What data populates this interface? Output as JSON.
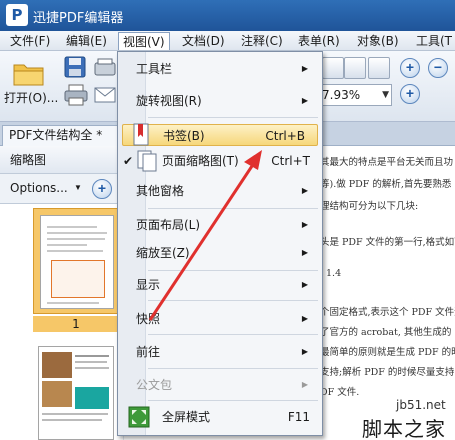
{
  "app": {
    "title": "迅捷PDF编辑器",
    "logo_letter": "P"
  },
  "menubar": {
    "items": [
      {
        "label": "文件(F)"
      },
      {
        "label": "编辑(E)"
      },
      {
        "label": "视图(V)"
      },
      {
        "label": "文档(D)"
      },
      {
        "label": "注释(C)"
      },
      {
        "label": "表单(R)"
      },
      {
        "label": "对象(B)"
      },
      {
        "label": "工具(T"
      }
    ]
  },
  "toolbar": {
    "open_label": "打开(O)...",
    "zoom_value": "7.93%"
  },
  "tabs": {
    "document_tab": "PDF文件结构全 *"
  },
  "panel": {
    "header": "缩略图",
    "options_label": "Options...",
    "thumbnail_page_label": "1"
  },
  "document": {
    "lines": [
      "其最大的特点是平台无关而且功",
      "等).做 PDF 的解析,首先要熟悉",
      "理结构可分为以下几块:",
      "头是 PDF 文件的第一行,格式如下",
      "1.4",
      "个固定格式,表示这个 PDF 文件遵",
      "了官方的 acrobat, 其他生成的",
      "最简单的原则就是生成 PDF 的时候",
      "支持;解析 PDF 的时候尽量支持",
      "DF 文件."
    ]
  },
  "view_menu": {
    "items": [
      {
        "label": "工具栏",
        "submenu": true
      },
      {
        "label": "旋转视图(R)",
        "submenu": true
      },
      {
        "label": "书签(B)",
        "shortcut": "Ctrl+B",
        "highlighted": true
      },
      {
        "label": "页面缩略图(T)",
        "shortcut": "Ctrl+T",
        "checked": true
      },
      {
        "label": "其他窗格",
        "submenu": true
      },
      {
        "label": "页面布局(L)",
        "submenu": true
      },
      {
        "label": "缩放至(Z)",
        "submenu": true
      },
      {
        "label": "显示",
        "submenu": true
      },
      {
        "label": "快照",
        "submenu": true
      },
      {
        "label": "前往",
        "submenu": true
      },
      {
        "label": "公文包",
        "submenu": true,
        "disabled": true
      },
      {
        "label": "全屏模式",
        "shortcut": "F11"
      }
    ],
    "arrow_glyph": "▶",
    "check_glyph": "✔"
  },
  "watermark": {
    "url": "jb51.net",
    "brand": "脚本之家"
  },
  "colors": {
    "titlebar": "#1f5499",
    "highlight": "#f6d77b",
    "annotation_arrow": "#e0302e",
    "thumbnail_selection": "#f6c768"
  },
  "icons": {
    "open_folder": "folder-icon",
    "save": "save-icon",
    "print": "print-icon",
    "email": "email-icon",
    "zoom_in": "zoom-in-icon",
    "zoom_out": "zoom-out-icon",
    "add": "plus-icon",
    "bookmark": "bookmark-icon",
    "page_thumbnail": "page-thumbnail-icon",
    "fullscreen": "fullscreen-icon"
  }
}
